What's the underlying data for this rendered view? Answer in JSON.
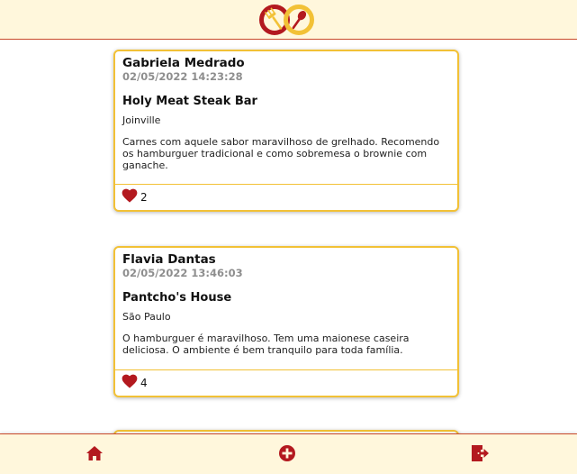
{
  "colors": {
    "accent_red": "#b3191f",
    "accent_yellow": "#f2c136",
    "header_bg": "#fff7dc"
  },
  "header": {
    "logo_icon": "fork-spoon-infinity-logo-icon"
  },
  "posts": [
    {
      "author": "Gabriela Medrado",
      "date": "02/05/2022 14:23:28",
      "place": "Holy Meat Steak Bar",
      "city": "Joinville",
      "text": "Carnes com aquele sabor maravilhoso de grelhado. Recomendo os hamburguer tradicional e como sobremesa o brownie com ganache.",
      "likes": "2"
    },
    {
      "author": "Flavia Dantas",
      "date": "02/05/2022 13:46:03",
      "place": "Pantcho's House",
      "city": "São Paulo",
      "text": "O hamburguer é maravilhoso. Tem uma maionese caseira deliciosa. O ambiente é bem tranquilo para toda família.",
      "likes": "4"
    }
  ],
  "bottom_nav": {
    "items": [
      "home-icon",
      "add-circle-icon",
      "logout-icon"
    ]
  }
}
